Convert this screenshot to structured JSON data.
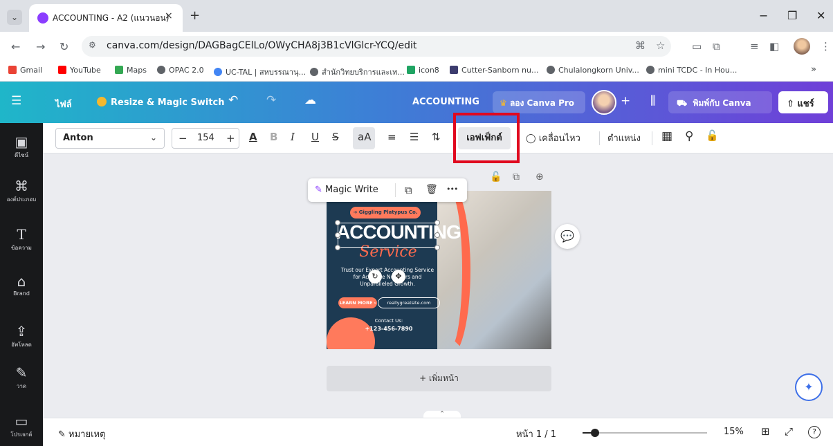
{
  "browser": {
    "tab_title": "ACCOUNTING - A2 (แนวนอน)",
    "tab_close": "×",
    "new_tab": "+",
    "menu_glyph": "⌄",
    "window_controls": [
      "−",
      "❐",
      "✕"
    ],
    "url": "canva.com/design/DAGBagCElLo/OWyCHA8j3B1cVlGlcr-YCQ/edit",
    "bookmarks": [
      {
        "label": "Gmail",
        "color": "#ea4335"
      },
      {
        "label": "YouTube",
        "color": "#ff0000"
      },
      {
        "label": "Maps",
        "color": "#34a853"
      },
      {
        "label": "OPAC 2.0",
        "color": "#5f6368"
      },
      {
        "label": "UC-TAL | สหบรรณานุ...",
        "color": "#4285f4"
      },
      {
        "label": "สำนักวิทยบริการและเท...",
        "color": "#5f6368"
      },
      {
        "label": "icon8",
        "color": "#1fa463"
      },
      {
        "label": "Cutter-Sanborn nu...",
        "color": "#3c3c6e"
      },
      {
        "label": "Chulalongkorn Univ...",
        "color": "#5f6368"
      },
      {
        "label": "mini TCDC - In Hou...",
        "color": "#5f6368"
      }
    ],
    "bookmarks_more": "»"
  },
  "header": {
    "menu_icon": "☰",
    "file_label": "ไฟล์",
    "resize_label": "Resize & Magic Switch",
    "undo": "↶",
    "redo": "↷",
    "cloud": "☁",
    "doc_title": "ACCOUNTING",
    "try_pro": "ลอง Canva Pro",
    "plus": "+",
    "chart_icon": "⫼",
    "print_label": "พิมพ์กับ Canva",
    "share_label": "แชร์"
  },
  "sidebar": [
    {
      "icon": "▣",
      "label": "ดีไซน์"
    },
    {
      "icon": "⌘",
      "label": "องค์ประกอบ"
    },
    {
      "icon": "T",
      "label": "ข้อความ"
    },
    {
      "icon": "⌂",
      "label": "Brand"
    },
    {
      "icon": "⇪",
      "label": "อัพโหลด"
    },
    {
      "icon": "✎",
      "label": "วาด"
    },
    {
      "icon": "▭",
      "label": "โปรเจกต์"
    }
  ],
  "toolbar": {
    "font_name": "Anton",
    "font_chevron": "⌄",
    "minus": "−",
    "font_size": "154",
    "plus": "+",
    "text_color": "A",
    "bold": "B",
    "italic": "I",
    "underline": "U",
    "strike": "S",
    "case": "aA",
    "align": "≡",
    "list": "☰",
    "spacing": "⇅",
    "effects": "เอฟเฟ็กต์",
    "animate": "เคลื่อนไหว",
    "position": "ตำแหน่ง",
    "transparency": "▦",
    "paint": "⚲",
    "lock": "🔓"
  },
  "canvas": {
    "magic_write": "Magic Write",
    "copy_icon": "⧉",
    "delete_icon": "🗑",
    "more_icon": "•••",
    "page_lock": "🔓",
    "page_copy": "⧉",
    "page_add": "⊕",
    "comment": "💬",
    "add_page": "+ เพิ่มหน้า",
    "assistant": "✦",
    "design": {
      "pill": "➔ Giggling Platypus Co.",
      "title": "ACCOUNTING",
      "script": "Service",
      "body": "Trust our Expert Accounting Service for Accurate Numbers and Unparalleled Growth.",
      "learn_more": "LEARN MORE ›",
      "website": "reallygreatsite.com",
      "contact_label": "Contact Us:",
      "phone": "+123-456-7890",
      "rotate": "↻",
      "move": "✥"
    }
  },
  "bottom": {
    "notes_icon": "✎",
    "notes_label": "หมายเหตุ",
    "page_indicator": "หน้า 1 / 1",
    "zoom": "15%",
    "zoom_fraction": 0.1,
    "grid_icon": "⊞",
    "fullscreen_icon": "⤢",
    "help_icon": "?",
    "up_chevron": "⌃"
  }
}
